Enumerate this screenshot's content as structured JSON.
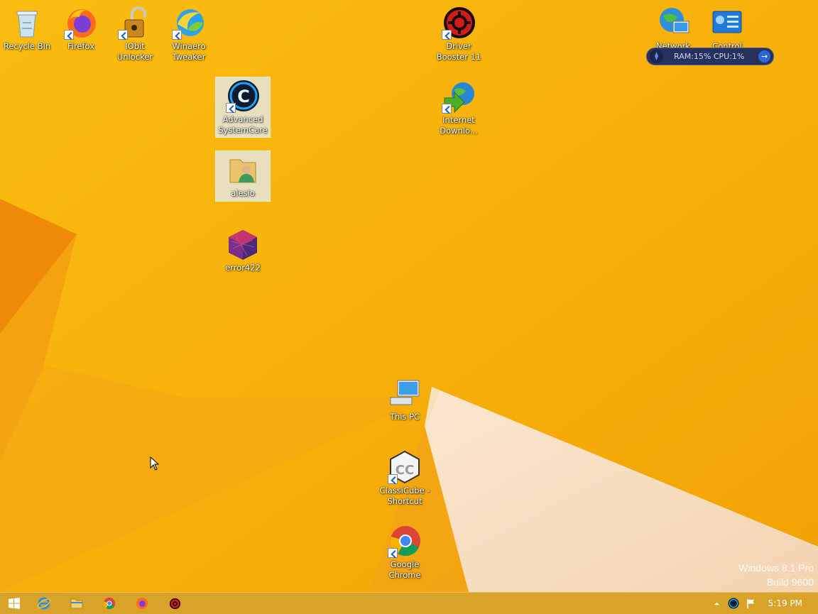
{
  "desktop": {
    "icons": [
      {
        "id": "recycle-bin",
        "label": "Recycle Bin"
      },
      {
        "id": "firefox",
        "label": "Firefox"
      },
      {
        "id": "iobit-unlocker",
        "label": "IObit\nUnlocker"
      },
      {
        "id": "winaero-tweaker",
        "label": "Winaero\nTweaker"
      },
      {
        "id": "advanced-systemcare",
        "label": "Advanced\nSystemCare"
      },
      {
        "id": "alesio",
        "label": "alesio"
      },
      {
        "id": "error422",
        "label": "error422"
      },
      {
        "id": "driver-booster",
        "label": "Driver\nBooster 11"
      },
      {
        "id": "internet-download",
        "label": "Internet\nDownlo..."
      },
      {
        "id": "network",
        "label": "Network"
      },
      {
        "id": "control-panel",
        "label": "Control Panel"
      },
      {
        "id": "this-pc",
        "label": "This PC"
      },
      {
        "id": "classicube",
        "label": "ClassiCube -\nShortcut"
      },
      {
        "id": "google-chrome",
        "label": "Google\nChrome"
      }
    ]
  },
  "gadget": {
    "text": "RAM:15%  CPU:1%"
  },
  "watermark": {
    "line1": "Windows 8.1 Pro",
    "line2": "Build 9600"
  },
  "taskbar": {
    "clock": "5:19 PM"
  },
  "colors": {
    "accent": "#f8b400",
    "taskbar": "#d9a32a"
  }
}
